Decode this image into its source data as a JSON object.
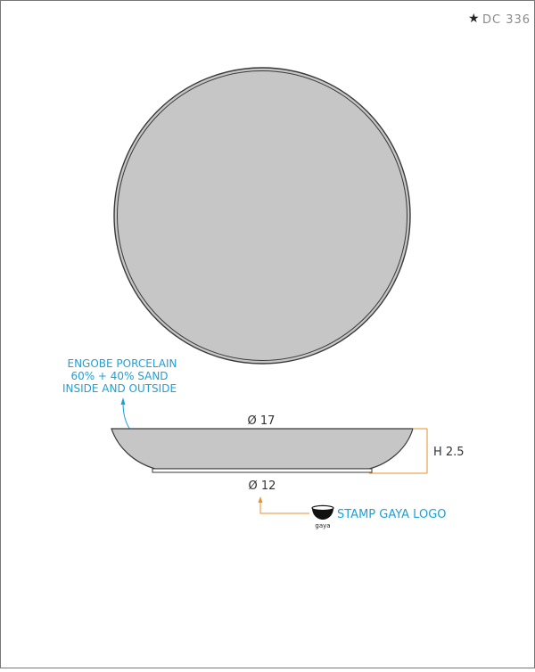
{
  "header": {
    "star": "★",
    "code": "DC 336"
  },
  "annotations": {
    "material_lines": [
      "ENGOBE PORCELAIN",
      "60% + 40% SAND",
      "INSIDE AND OUTSIDE"
    ],
    "top_diameter": "Ø 17",
    "height": "H 2.5",
    "bottom_diameter": "Ø 12",
    "stamp": "STAMP GAYA LOGO",
    "logo_text": "gaya"
  },
  "colors": {
    "blue_text": "#1ea0d8",
    "orange_line": "#e8902c",
    "plate_fill": "#c6c6c6",
    "outline": "#3a3a3a",
    "border": "#777777",
    "header_text": "#8a8a8a"
  }
}
